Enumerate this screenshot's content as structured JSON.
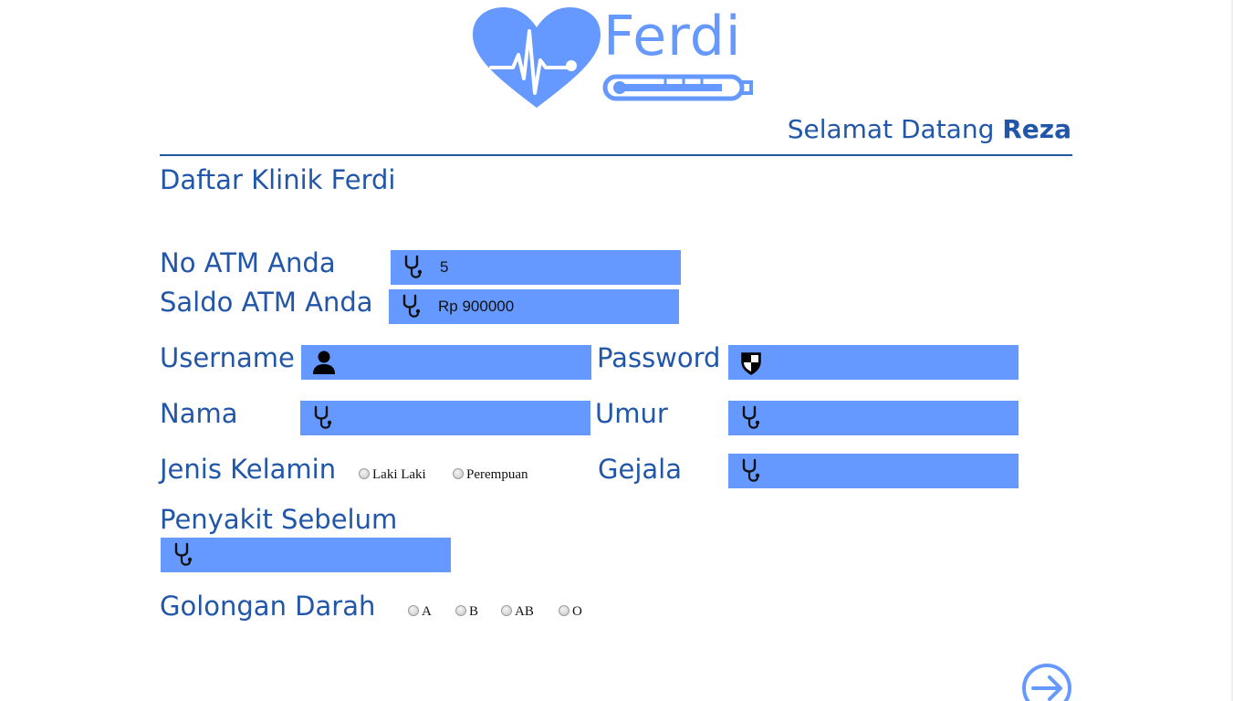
{
  "colors": {
    "brand_blue": "#2156a8",
    "field_blue": "#6699ff",
    "logo_blue": "#6699ff"
  },
  "header": {
    "logo_text": "Ferdi",
    "logo_icon": "heart-pulse-thermometer-logo",
    "welcome_prefix": "Selamat Datang",
    "welcome_user": "Reza"
  },
  "page_title": "Daftar Klinik Ferdi",
  "form": {
    "atm_number": {
      "label": "No ATM Anda",
      "value": "5",
      "icon": "stethoscope-icon"
    },
    "atm_balance": {
      "label": "Saldo ATM Anda",
      "value": "Rp 900000",
      "icon": "stethoscope-icon"
    },
    "username": {
      "label": "Username",
      "value": "",
      "icon": "user-icon"
    },
    "password": {
      "label": "Password",
      "value": "",
      "icon": "shield-icon"
    },
    "nama": {
      "label": "Nama",
      "value": "",
      "icon": "stethoscope-icon"
    },
    "umur": {
      "label": "Umur",
      "value": "",
      "icon": "stethoscope-icon"
    },
    "jenis_kelamin": {
      "label": "Jenis Kelamin",
      "options": [
        "Laki Laki",
        "Perempuan"
      ],
      "selected": null
    },
    "gejala": {
      "label": "Gejala",
      "value": "",
      "icon": "stethoscope-icon"
    },
    "penyakit_sebelum": {
      "label": "Penyakit Sebelum",
      "value": "",
      "icon": "stethoscope-icon"
    },
    "golongan_darah": {
      "label": "Golongan Darah",
      "options": [
        "A",
        "B",
        "AB",
        "O"
      ],
      "selected": null
    },
    "submit_icon": "arrow-right-circle-icon"
  }
}
